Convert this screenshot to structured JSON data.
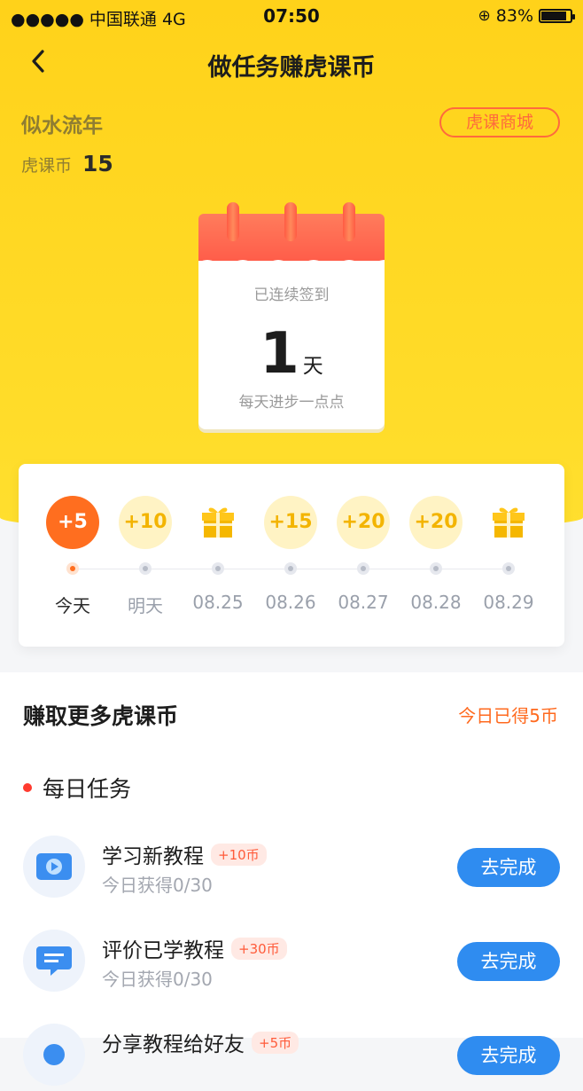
{
  "status": {
    "carrier": "●●●●● 中国联通  4G",
    "time": "07:50",
    "battery": "83%"
  },
  "nav": {
    "title": "做任务赚虎课币"
  },
  "user": {
    "name": "似水流年",
    "coin_label": "虎课币",
    "coins": "15",
    "mall_label": "虎课商城"
  },
  "calendar": {
    "subtitle": "已连续签到",
    "days": "1",
    "unit": "天",
    "footer": "每天进步一点点"
  },
  "signin": {
    "days": [
      {
        "reward": "+5",
        "date": "今天",
        "type": "coin",
        "state": "today"
      },
      {
        "reward": "+10",
        "date": "明天",
        "type": "coin",
        "state": "future"
      },
      {
        "reward": "",
        "date": "08.25",
        "type": "gift",
        "state": "future"
      },
      {
        "reward": "+15",
        "date": "08.26",
        "type": "coin",
        "state": "future"
      },
      {
        "reward": "+20",
        "date": "08.27",
        "type": "coin",
        "state": "future"
      },
      {
        "reward": "+20",
        "date": "08.28",
        "type": "coin",
        "state": "future"
      },
      {
        "reward": "",
        "date": "08.29",
        "type": "gift",
        "state": "future"
      }
    ]
  },
  "earn": {
    "title": "赚取更多虎课币",
    "today_earned": "今日已得5币",
    "daily_label": "每日任务",
    "tasks": [
      {
        "name": "学习新教程",
        "badge": "+10币",
        "progress": "今日获得0/30",
        "button": "去完成",
        "icon": "video-play-icon"
      },
      {
        "name": "评价已学教程",
        "badge": "+30币",
        "progress": "今日获得0/30",
        "button": "去完成",
        "icon": "comment-icon"
      },
      {
        "name": "分享教程给好友",
        "badge": "+5币",
        "progress": "",
        "button": "去完成",
        "icon": "share-icon"
      }
    ]
  },
  "colors": {
    "hero": "#ffd21a",
    "accent_orange": "#ff6e1f",
    "primary_blue": "#2f8cf0"
  }
}
